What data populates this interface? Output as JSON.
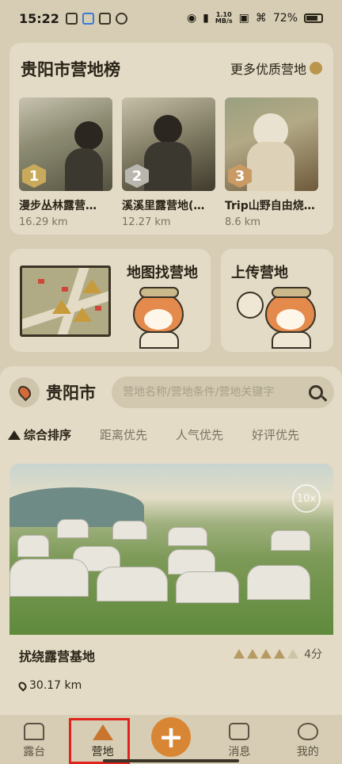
{
  "status_bar": {
    "time": "15:22",
    "net_speed_top": "1.10",
    "net_speed_bottom": "MB/s",
    "battery": "72%"
  },
  "ranking": {
    "title": "贵阳市营地榜",
    "more_label": "更多优质营地",
    "items": [
      {
        "rank": "1",
        "name": "漫步丛林露营…",
        "distance": "16.29 km"
      },
      {
        "rank": "2",
        "name": "溪溪里露营地(…",
        "distance": "12.27 km"
      },
      {
        "rank": "3",
        "name": "Trip山野自由烧…",
        "distance": "8.6 km"
      }
    ]
  },
  "map_card": {
    "title": "地图找营地"
  },
  "upload_card": {
    "title": "上传营地"
  },
  "city": {
    "name": "贵阳市"
  },
  "search": {
    "placeholder": "营地名称/营地条件/营地关键字"
  },
  "sort_tabs": [
    {
      "label": "综合排序",
      "active": true
    },
    {
      "label": "距离优先"
    },
    {
      "label": "人气优先"
    },
    {
      "label": "好评优先"
    }
  ],
  "camp": {
    "name": "扰绕露营基地",
    "rating_text": "4分",
    "rating": 4,
    "rating_max": 5,
    "distance": "30.17 km",
    "zoom_badge": "10x"
  },
  "nav": {
    "items": [
      {
        "label": "露台",
        "icon": "sofa-icon"
      },
      {
        "label": "营地",
        "icon": "tent-icon",
        "active": true
      },
      {
        "label": "",
        "icon": "plus-icon"
      },
      {
        "label": "消息",
        "icon": "message-icon"
      },
      {
        "label": "我的",
        "icon": "cat-icon"
      }
    ],
    "add_symbol": "+"
  },
  "colors": {
    "background": "#d7cdb4",
    "card": "#e3dbc6",
    "accent": "#d98634",
    "highlight": "#e0241d"
  }
}
